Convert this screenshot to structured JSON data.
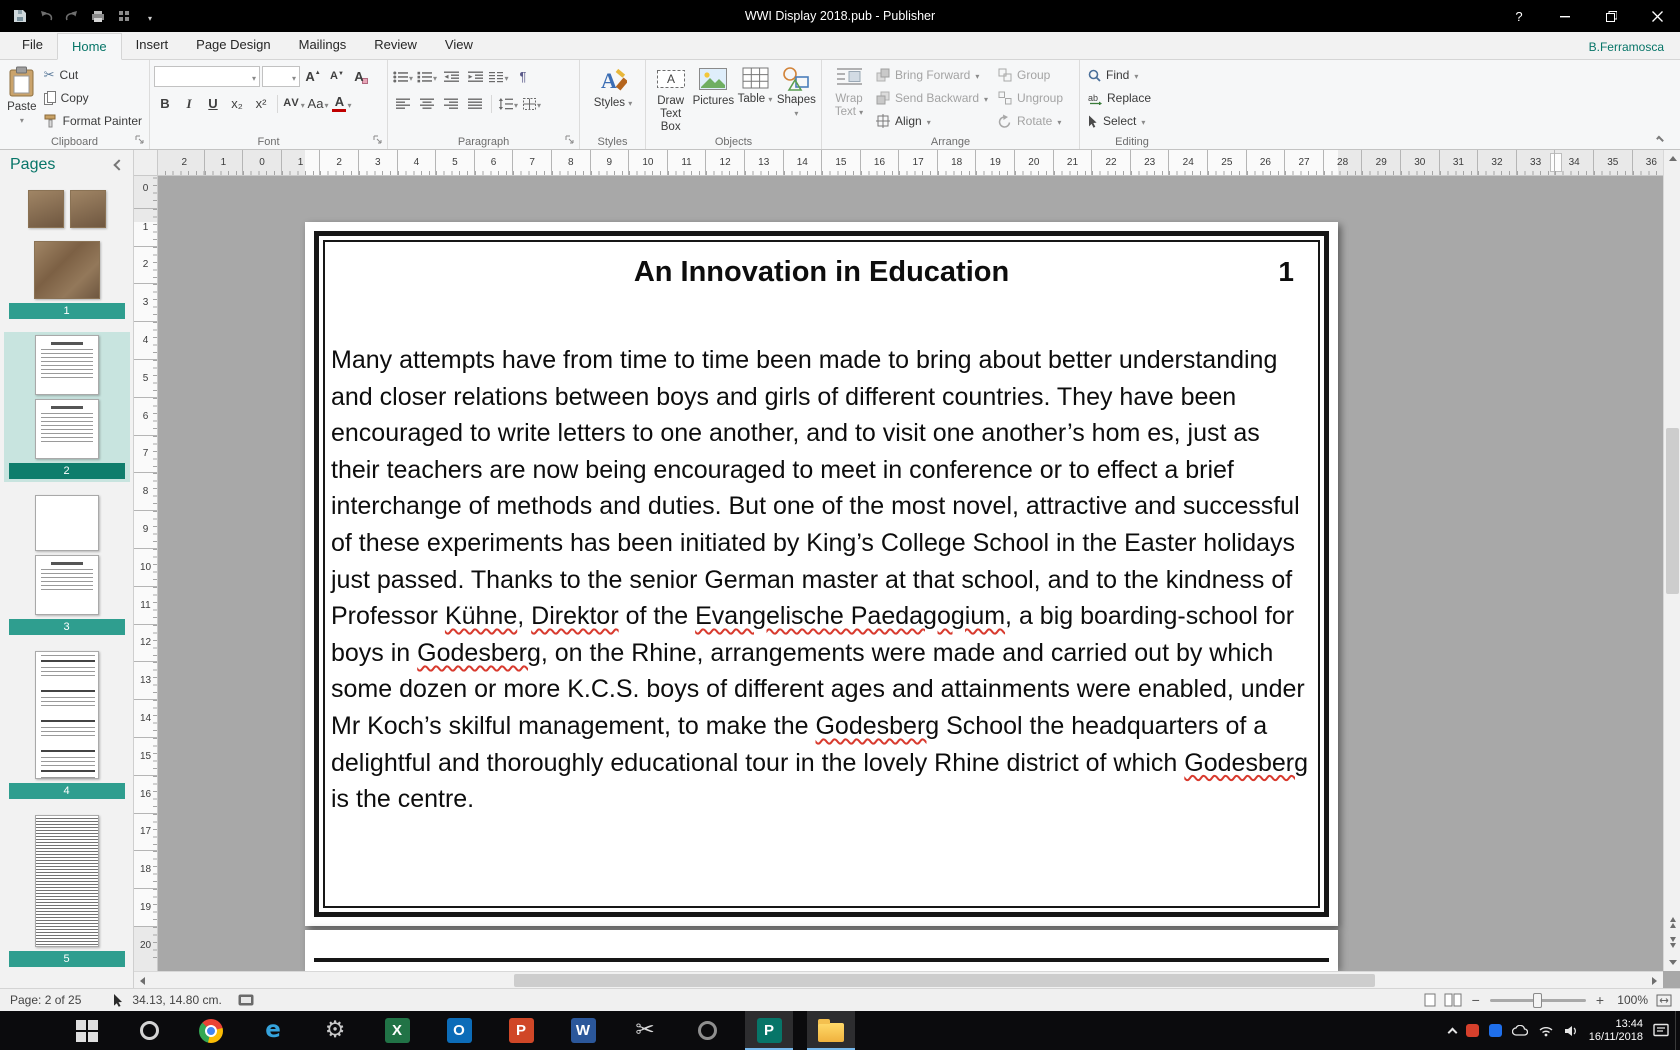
{
  "title_bar": {
    "title": "WWI Display 2018.pub - Publisher"
  },
  "icons": {
    "help": "?",
    "scissors": "✂",
    "zoom_out": "−",
    "zoom_in": "+",
    "pilcrow": "¶"
  },
  "ribbon": {
    "tabs": [
      {
        "label": "File",
        "active": false
      },
      {
        "label": "Home",
        "active": true
      },
      {
        "label": "Insert",
        "active": false
      },
      {
        "label": "Page Design",
        "active": false
      },
      {
        "label": "Mailings",
        "active": false
      },
      {
        "label": "Review",
        "active": false
      },
      {
        "label": "View",
        "active": false
      }
    ],
    "account_name": "B.Ferramosca",
    "groups": {
      "clipboard": {
        "label": "Clipboard",
        "paste": "Paste",
        "cut": "Cut",
        "copy": "Copy",
        "format_painter": "Format Painter"
      },
      "font": {
        "label": "Font",
        "name_value": "",
        "size_value": "",
        "bold": "B",
        "italic": "I",
        "underline": "U",
        "subscript": "x₂",
        "superscript": "x²",
        "change_case": "Aa",
        "character_spacing": "AV",
        "font_color": "A"
      },
      "paragraph": {
        "label": "Paragraph"
      },
      "styles": {
        "label": "Styles",
        "styles_button": "Styles"
      },
      "objects": {
        "label": "Objects",
        "draw_text_box": "Draw Text Box",
        "pictures": "Pictures",
        "table": "Table",
        "shapes": "Shapes"
      },
      "arrange": {
        "label": "Arrange",
        "wrap_text": "Wrap Text",
        "bring_forward": "Bring Forward",
        "send_backward": "Send Backward",
        "align": "Align",
        "group": "Group",
        "ungroup": "Ungroup",
        "rotate": "Rotate"
      },
      "editing": {
        "label": "Editing",
        "find": "Find",
        "replace": "Replace",
        "select": "Select"
      }
    }
  },
  "pages_panel": {
    "title": "Pages",
    "pages": [
      {
        "number": "1"
      },
      {
        "number": "2",
        "current": true
      },
      {
        "number": "3"
      },
      {
        "number": "4"
      },
      {
        "number": "5"
      }
    ]
  },
  "ruler": {
    "horizontal": [
      "2",
      "1",
      "0",
      "1",
      "2",
      "3",
      "4",
      "5",
      "6",
      "7",
      "8",
      "9",
      "10",
      "11",
      "12",
      "13",
      "14",
      "15",
      "16",
      "17",
      "18",
      "19",
      "20",
      "21",
      "22",
      "23",
      "24",
      "25",
      "26",
      "27",
      "28",
      "29",
      "30",
      "31",
      "32",
      "33",
      "34",
      "35",
      "36"
    ],
    "vertical": [
      "0",
      "1",
      "2",
      "3",
      "4",
      "5",
      "6",
      "7",
      "8",
      "9",
      "10",
      "11",
      "12",
      "13",
      "14",
      "15",
      "16",
      "17",
      "18",
      "19",
      "20"
    ]
  },
  "document": {
    "title": "An Innovation in Education",
    "page_number": "1",
    "body_segments": [
      {
        "t": "Many attempts have from time to time been made to bring about better understanding and closer relations between boys and girls of different countries. They have been encouraged to write letters to one another, and to visit one another’s hom es, just as their teachers are now being encouraged to meet in conference or to effect a brief interchange of methods and duties. But one of the most novel, attractive and successful of these experiments has been initiated by King’s College School in the Easter holidays just passed. Thanks to the senior German master at that school, and to the kindness of Professor "
      },
      {
        "t": "Kühne",
        "err": true
      },
      {
        "t": ", "
      },
      {
        "t": "Direktor",
        "err": true
      },
      {
        "t": " of the "
      },
      {
        "t": "Evangelische Paedagogium",
        "err": true
      },
      {
        "t": ", a big boarding-school for boys in "
      },
      {
        "t": "Godesberg",
        "err": true
      },
      {
        "t": ", on the Rhine, arrangements were made and carried out by which some dozen or more K.C.S. boys of different ages and attainments were enabled, under Mr Koch’s skilful management, to make the "
      },
      {
        "t": "Godesberg",
        "err": true
      },
      {
        "t": " School the headquarters of a delightful and thoroughly educational tour in the lovely Rhine district of which "
      },
      {
        "t": "Godesberg",
        "err": true
      },
      {
        "t": " is the centre."
      }
    ]
  },
  "status_bar": {
    "page_indicator": "Page: 2 of 25",
    "coordinates": "34.13, 14.80 cm.",
    "zoom_level": "100%"
  },
  "taskbar": {
    "items": [
      {
        "name": "start-button",
        "type": "start"
      },
      {
        "name": "cortana-search-button",
        "type": "ring",
        "color": "#d4d4d4"
      },
      {
        "name": "chrome-button",
        "type": "chrome"
      },
      {
        "name": "edge-button",
        "type": "glyph",
        "label": "e",
        "color": "#35a3dc"
      },
      {
        "name": "settings-button",
        "type": "glyph",
        "label": "⚙",
        "color": "#c8c8c8"
      },
      {
        "name": "excel-button",
        "type": "tile",
        "label": "X",
        "bg": "#217346"
      },
      {
        "name": "outlook-button",
        "type": "tile",
        "label": "O",
        "bg": "#0c6cb8"
      },
      {
        "name": "powerpoint-button",
        "type": "tile",
        "label": "P",
        "bg": "#d04727"
      },
      {
        "name": "word-button",
        "type": "tile",
        "label": "W",
        "bg": "#2b579a"
      },
      {
        "name": "snipping-tool-button",
        "type": "glyph",
        "label": "✂",
        "color": "#d8d8d8"
      },
      {
        "name": "camera-app-button",
        "type": "ring",
        "color": "#8f8f8f"
      },
      {
        "name": "publisher-button",
        "type": "tile",
        "label": "P",
        "bg": "#077568",
        "active": true
      },
      {
        "name": "file-explorer-button",
        "type": "folder",
        "active": true
      }
    ],
    "clock_time": "13:44",
    "clock_date": "16/11/2018"
  },
  "colors": {
    "accent": "#077568",
    "spell_error": "#d83a2e"
  }
}
